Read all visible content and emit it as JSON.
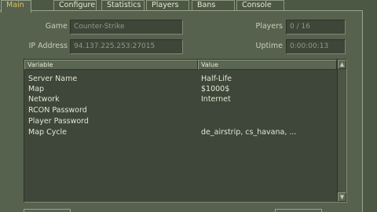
{
  "tabs": [
    {
      "label": "Main",
      "active": true
    },
    {
      "label": "Configure",
      "active": false
    },
    {
      "label": "Statistics",
      "active": false
    },
    {
      "label": "Players",
      "active": false
    },
    {
      "label": "Bans",
      "active": false
    },
    {
      "label": "Console",
      "active": false
    }
  ],
  "info": {
    "game_label": "Game",
    "game_value": "Counter-Strike",
    "ip_label": "IP Address",
    "ip_value": "94.137.225.253:27015",
    "players_label": "Players",
    "players_value": "0 / 16",
    "uptime_label": "Uptime",
    "uptime_value": "0:00:00:13"
  },
  "table": {
    "columns": [
      "Variable",
      "Value"
    ],
    "rows": [
      {
        "variable": "Server Name",
        "value": "Half-Life"
      },
      {
        "variable": "Map",
        "value": "$1000$"
      },
      {
        "variable": "Network",
        "value": "Internet"
      },
      {
        "variable": "RCON Password",
        "value": ""
      },
      {
        "variable": "Player Password",
        "value": ""
      },
      {
        "variable": "Map Cycle",
        "value": "de_airstrip, cs_havana, ..."
      }
    ]
  },
  "colors": {
    "background": "#4c5844",
    "panel": "#56624e",
    "field": "#3d4638",
    "active_tab_text": "#e0c060"
  }
}
